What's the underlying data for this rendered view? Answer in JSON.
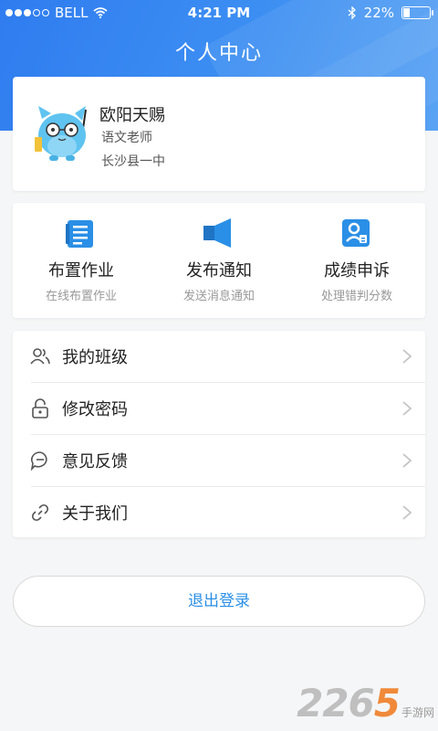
{
  "status_bar": {
    "carrier": "BELL",
    "time": "4:21 PM",
    "battery": "22%",
    "battery_level": 0.22
  },
  "header": {
    "title": "个人中心"
  },
  "profile": {
    "name": "欧阳天赐",
    "role": "语文老师",
    "school": "长沙县一中",
    "avatar_icon": "cartoon-cat-avatar-icon"
  },
  "actions": [
    {
      "icon": "homework-icon",
      "label": "布置作业",
      "sub": "在线布置作业"
    },
    {
      "icon": "megaphone-icon",
      "label": "发布通知",
      "sub": "发送消息通知"
    },
    {
      "icon": "appeal-icon",
      "label": "成绩申诉",
      "sub": "处理错判分数"
    }
  ],
  "menu": [
    {
      "icon": "users-icon",
      "label": "我的班级"
    },
    {
      "icon": "lock-icon",
      "label": "修改密码"
    },
    {
      "icon": "feedback-icon",
      "label": "意见反馈"
    },
    {
      "icon": "link-icon",
      "label": "关于我们"
    }
  ],
  "logout_label": "退出登录",
  "watermark": {
    "number": "2265",
    "text": "手游网"
  },
  "colors": {
    "header_blue": "#3a8cf2",
    "accent": "#2a8fe6",
    "watermark_orange": "#f08a3a"
  }
}
